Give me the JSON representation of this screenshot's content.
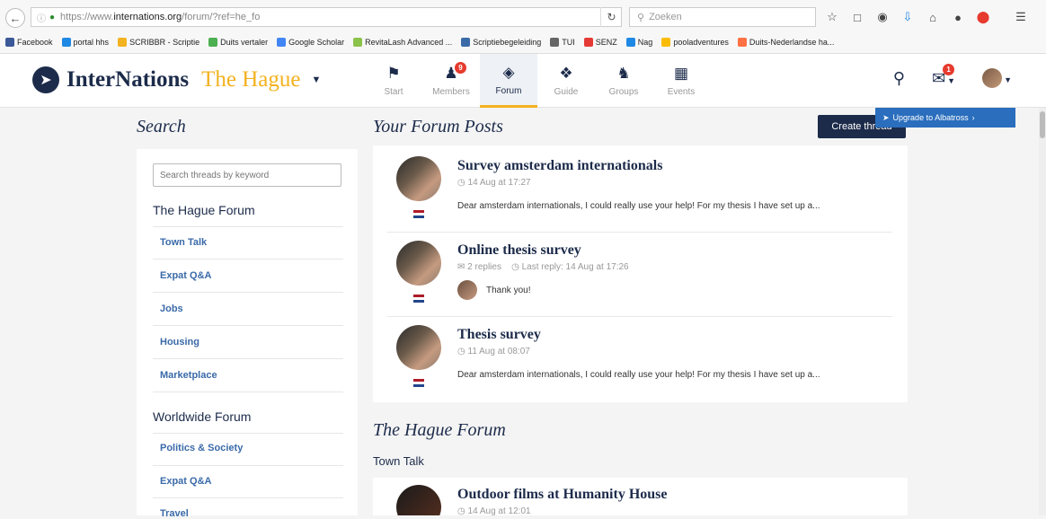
{
  "browser": {
    "url_prefix": "https://www.",
    "url_host": "internations.org",
    "url_path": "/forum/?ref=he_fo",
    "search_placeholder": "Zoeken",
    "bookmarks": [
      {
        "label": "Facebook",
        "color": "#3b5998"
      },
      {
        "label": "portal hhs",
        "color": "#1e88e5"
      },
      {
        "label": "SCRIBBR - Scriptie",
        "color": "#f3b21f"
      },
      {
        "label": "Duits vertaler",
        "color": "#4caf50"
      },
      {
        "label": "Google Scholar",
        "color": "#4285f4"
      },
      {
        "label": "RevitaLash Advanced ...",
        "color": "#8bc34a"
      },
      {
        "label": "Scriptiebegeleiding",
        "color": "#3a6aa8"
      },
      {
        "label": "TUI",
        "color": "#666666"
      },
      {
        "label": "SENZ",
        "color": "#e53935"
      },
      {
        "label": "Nag",
        "color": "#1e88e5"
      },
      {
        "label": "pooladventures",
        "color": "#fbbc05"
      },
      {
        "label": "Duits-Nederlandse ha...",
        "color": "#ff7043"
      }
    ]
  },
  "header": {
    "brand": "InterNations",
    "city": "The Hague",
    "nav": [
      {
        "label": "Start",
        "icon": "flag-icon"
      },
      {
        "label": "Members",
        "icon": "members-icon",
        "badge": "9"
      },
      {
        "label": "Forum",
        "icon": "forum-icon",
        "active": true
      },
      {
        "label": "Guide",
        "icon": "guide-icon"
      },
      {
        "label": "Groups",
        "icon": "groups-icon"
      },
      {
        "label": "Events",
        "icon": "calendar-icon"
      }
    ],
    "messages_badge": "1"
  },
  "sidebar": {
    "title": "Search",
    "search_placeholder": "Search threads by keyword",
    "local_forum": "The Hague Forum",
    "local_links": [
      "Town Talk",
      "Expat Q&A",
      "Jobs",
      "Housing",
      "Marketplace"
    ],
    "worldwide_forum": "Worldwide Forum",
    "worldwide_links": [
      "Politics & Society",
      "Expat Q&A",
      "Travel"
    ]
  },
  "main": {
    "title": "Your Forum Posts",
    "create_button": "Create thread",
    "upgrade_label": "Upgrade to Albatross",
    "posts": [
      {
        "title": "Survey amsterdam internationals",
        "meta": "14 Aug at 17:27",
        "snippet": "Dear amsterdam internationals, I could really use your help! For my thesis I have set up a..."
      },
      {
        "title": "Online thesis survey",
        "replies": "2 replies",
        "last_reply": "Last reply: 14 Aug at 17:26",
        "reply_text": "Thank you!"
      },
      {
        "title": "Thesis survey",
        "meta": "11 Aug at 08:07",
        "snippet": "Dear amsterdam internationals, I could really use your help! For my thesis I have set up a..."
      }
    ],
    "forum_title": "The Hague Forum",
    "forum_subsection": "Town Talk",
    "town_talk_post": {
      "title": "Outdoor films at Humanity House",
      "meta": "14 Aug at 12:01"
    }
  },
  "colors": {
    "brand_navy": "#1c2b4a",
    "brand_gold": "#f3b21f",
    "badge_red": "#e63b2e",
    "link_blue": "#3a6aa8",
    "upgrade_blue": "#2a6ebd"
  }
}
